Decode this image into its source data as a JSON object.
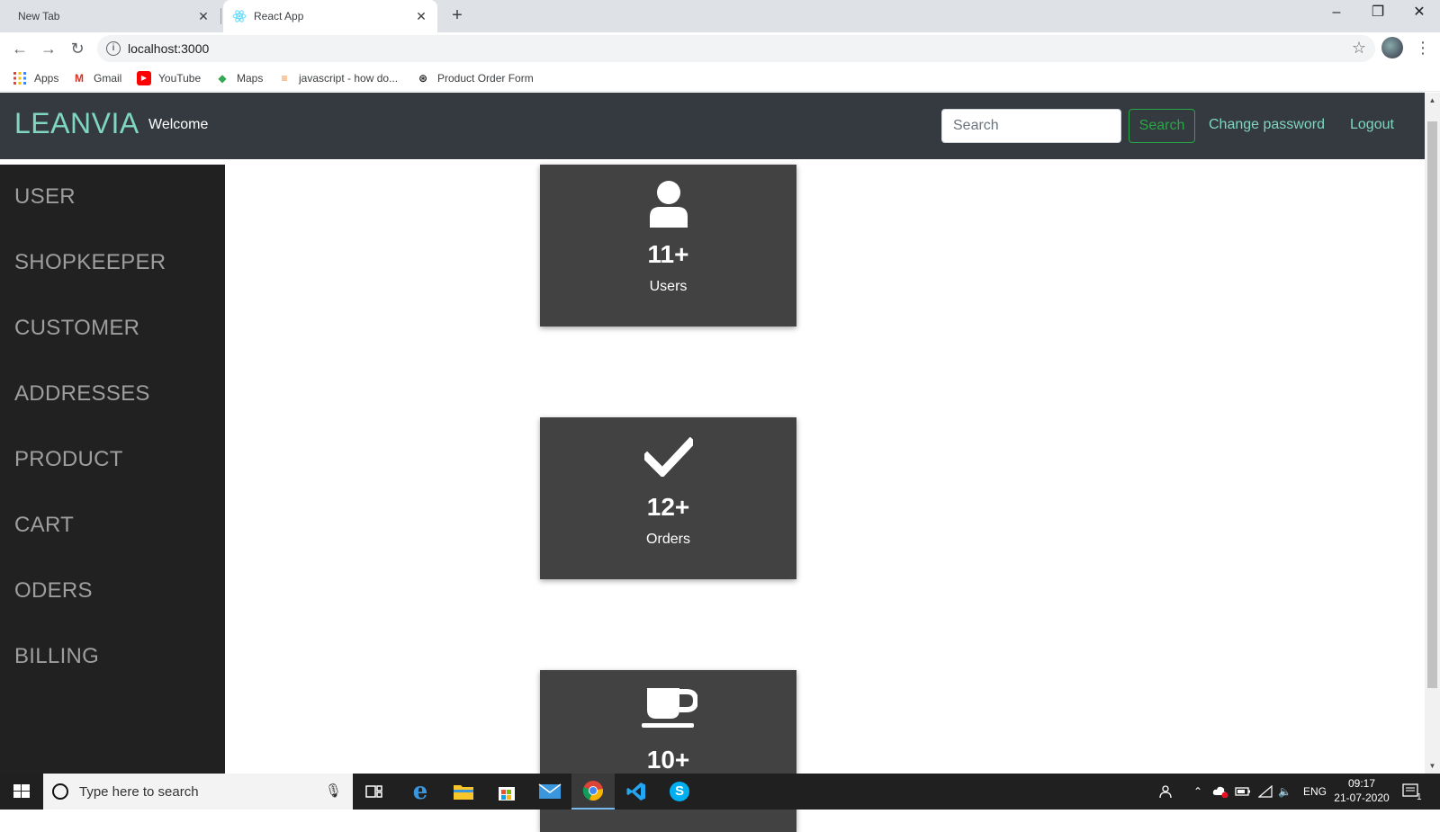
{
  "browser": {
    "tabs": [
      {
        "title": "New Tab",
        "active": false
      },
      {
        "title": "React App",
        "active": true
      }
    ],
    "url": "localhost:3000",
    "bookmarks": [
      {
        "label": "Apps",
        "icon": "apps-grid-icon"
      },
      {
        "label": "Gmail",
        "icon": "gmail-icon"
      },
      {
        "label": "YouTube",
        "icon": "youtube-icon"
      },
      {
        "label": "Maps",
        "icon": "maps-icon"
      },
      {
        "label": "javascript - how do...",
        "icon": "stackoverflow-icon"
      },
      {
        "label": "Product Order Form",
        "icon": "form-icon"
      }
    ]
  },
  "navbar": {
    "brand": "LEANVIA",
    "welcome": "Welcome",
    "search_placeholder": "Search",
    "search_button": "Search",
    "change_password": "Change password",
    "logout": "Logout"
  },
  "sidebar": {
    "items": [
      {
        "label": "USER"
      },
      {
        "label": "SHOPKEEPER"
      },
      {
        "label": "CUSTOMER"
      },
      {
        "label": "ADDRESSES"
      },
      {
        "label": "PRODUCT"
      },
      {
        "label": "CART"
      },
      {
        "label": "ODERS"
      },
      {
        "label": "BILLING"
      }
    ]
  },
  "cards": [
    {
      "icon": "user-icon",
      "count": "11+",
      "label": "Users"
    },
    {
      "icon": "checkmark-icon",
      "count": "12+",
      "label": "Orders"
    },
    {
      "icon": "coffee-cup-icon",
      "count": "10+",
      "label": ""
    }
  ],
  "taskbar": {
    "search_placeholder": "Type here to search",
    "language": "ENG",
    "time": "09:17",
    "date": "21-07-2020",
    "notification_count": "1"
  },
  "colors": {
    "navbar_bg": "#343a40",
    "brand": "#7fd6c2",
    "sidebar_bg": "#212121",
    "card_bg": "#424242",
    "search_button": "#28a745"
  }
}
